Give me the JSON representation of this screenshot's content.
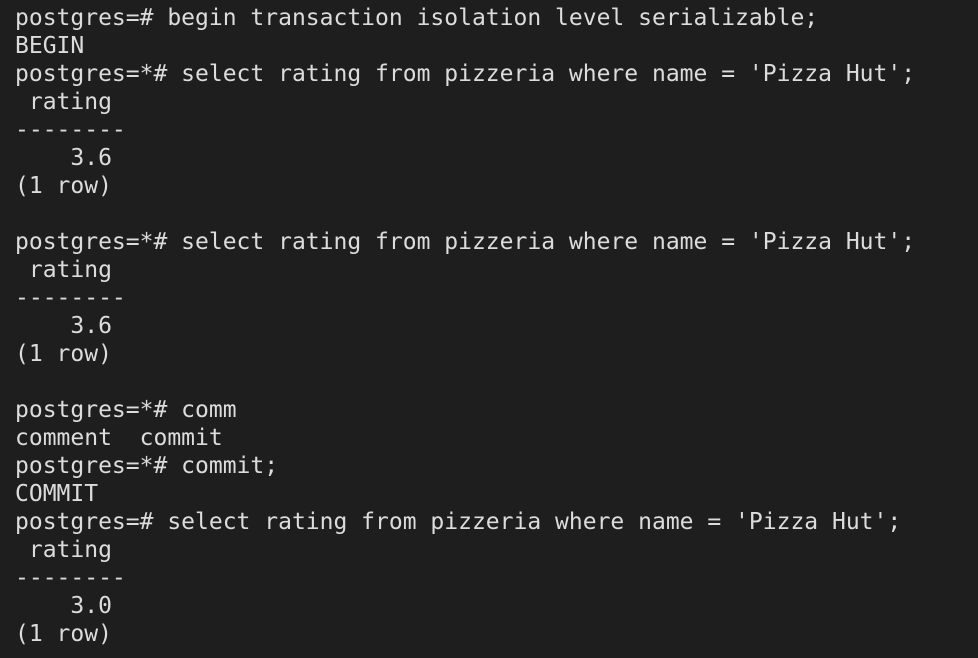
{
  "terminal": {
    "lines": [
      "postgres=# begin transaction isolation level serializable;",
      "BEGIN",
      "postgres=*# select rating from pizzeria where name = 'Pizza Hut';",
      " rating",
      "--------",
      "    3.6",
      "(1 row)",
      "",
      "postgres=*# select rating from pizzeria where name = 'Pizza Hut';",
      " rating",
      "--------",
      "    3.6",
      "(1 row)",
      "",
      "postgres=*# comm",
      "comment  commit",
      "postgres=*# commit;",
      "COMMIT",
      "postgres=# select rating from pizzeria where name = 'Pizza Hut';",
      " rating",
      "--------",
      "    3.0",
      "(1 row)"
    ]
  }
}
